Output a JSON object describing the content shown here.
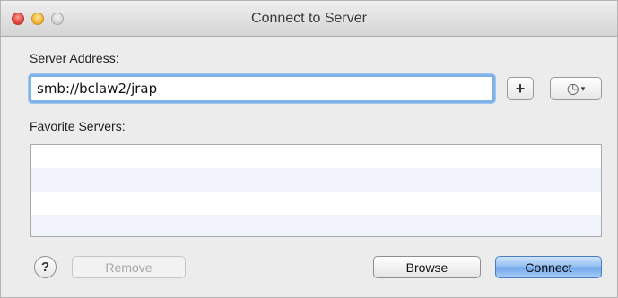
{
  "window": {
    "title": "Connect to Server"
  },
  "server_address": {
    "label": "Server Address:",
    "value": "smb://bclaw2/jrap"
  },
  "add_button": {
    "label": "+"
  },
  "recent_button": {
    "icon": "clock-icon",
    "caret": "▾"
  },
  "favorites": {
    "label": "Favorite Servers:",
    "items": []
  },
  "buttons": {
    "help": "?",
    "remove": "Remove",
    "browse": "Browse",
    "connect": "Connect"
  },
  "colors": {
    "focus_ring": "#7fb2e6",
    "connect_default": "#8fbcf0",
    "row_alternate": "#f0f4fa"
  }
}
